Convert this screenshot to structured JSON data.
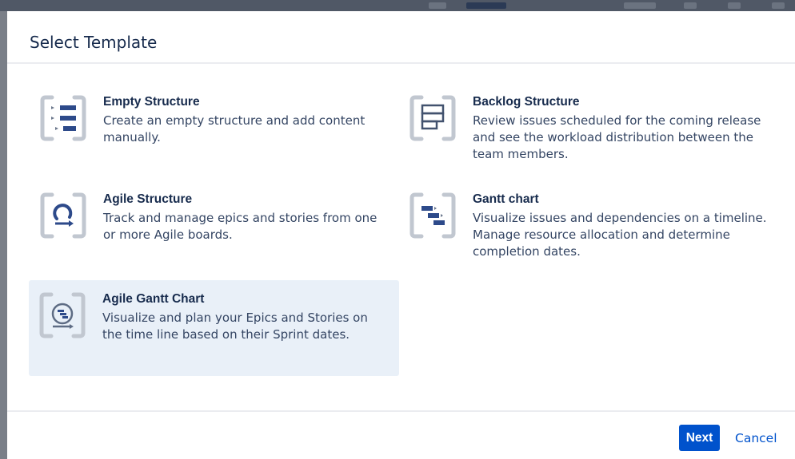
{
  "dialog": {
    "title": "Select Template",
    "templates": [
      {
        "name": "Empty Structure",
        "description": "Create an empty structure and add content manually.",
        "icon": "empty-structure-icon",
        "selected": false
      },
      {
        "name": "Backlog Structure",
        "description": "Review issues scheduled for the coming release and see the workload distribution between the team members.",
        "icon": "backlog-structure-icon",
        "selected": false
      },
      {
        "name": "Agile Structure",
        "description": "Track and manage epics and stories from one or more Agile boards.",
        "icon": "agile-structure-icon",
        "selected": false
      },
      {
        "name": "Gantt chart",
        "description": "Visualize issues and dependencies on a timeline. Manage resource allocation and determine completion dates.",
        "icon": "gantt-chart-icon",
        "selected": false
      },
      {
        "name": "Agile Gantt Chart",
        "description": "Visualize and plan your Epics and Stories on the time line based on their Sprint dates.",
        "icon": "agile-gantt-chart-icon",
        "selected": true
      }
    ],
    "footer": {
      "next_label": "Next",
      "cancel_label": "Cancel"
    }
  },
  "colors": {
    "primary": "#0052cc",
    "selected_bg": "#e9f0f8",
    "icon_bracket": "#c1c7d0",
    "icon_blue": "#2d4a8a"
  }
}
